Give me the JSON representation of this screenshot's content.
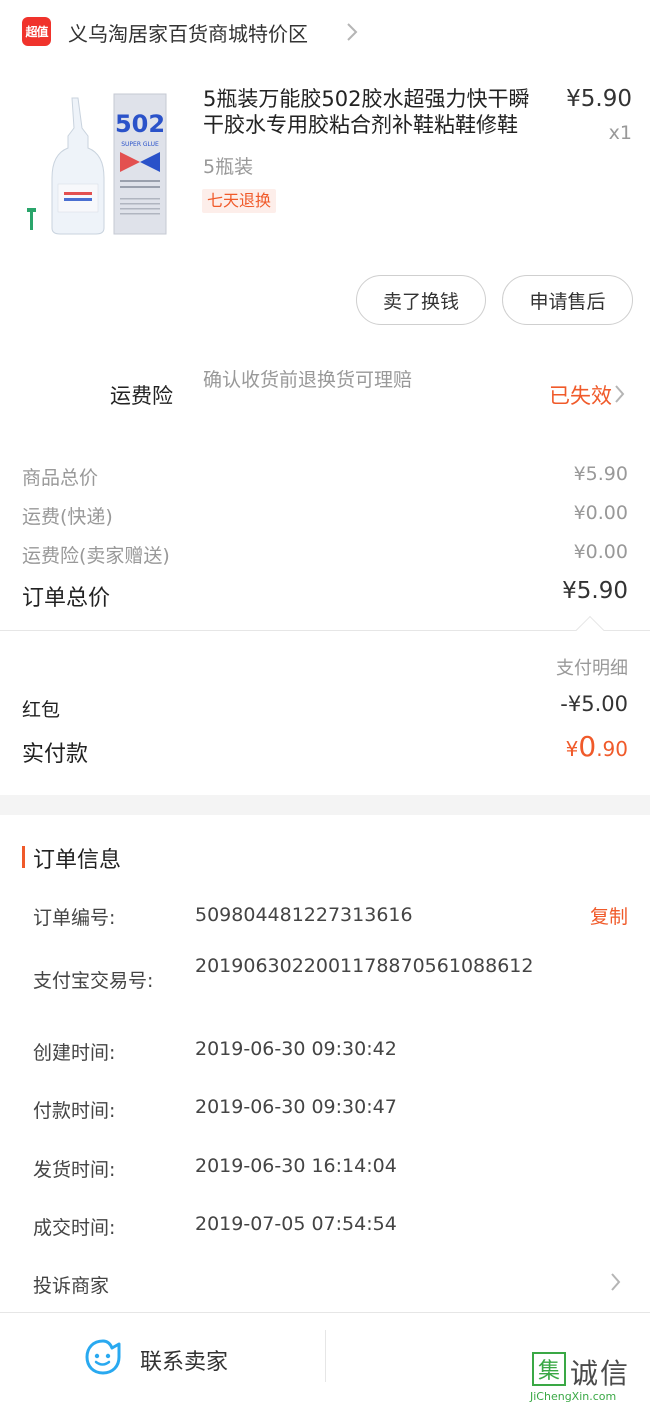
{
  "store": {
    "badge": "超值",
    "name": "义乌淘居家百货商城特价区"
  },
  "product": {
    "title": "5瓶装万能胶502胶水超强力快干瞬干胶水专用胶粘合剂补鞋粘鞋修鞋",
    "price": "¥5.90",
    "quantity": "x1",
    "sku": "5瓶装",
    "tag": "七天退换",
    "image_label": "502",
    "image_sub": "SUPER GLUE"
  },
  "actions": {
    "sell_label": "卖了换钱",
    "aftersale_label": "申请售后"
  },
  "insurance": {
    "label": "运费险",
    "description": "确认收货前退换货可理赔",
    "status": "已失效"
  },
  "price_rows": [
    {
      "label": "商品总价",
      "value": "¥5.90"
    },
    {
      "label": "运费(快递)",
      "value": "¥0.00"
    },
    {
      "label": "运费险(卖家赠送)",
      "value": "¥0.00"
    }
  ],
  "total": {
    "label": "订单总价",
    "value": "¥5.90"
  },
  "payment": {
    "detail_label": "支付明细",
    "hongbao_label": "红包",
    "hongbao_value": "-¥5.00",
    "paid_label": "实付款",
    "paid_currency": "¥",
    "paid_int": "0",
    "paid_dec": ".90"
  },
  "order_info": {
    "title": "订单信息",
    "copy_label": "复制",
    "rows": [
      {
        "label": "订单编号:",
        "value": "509804481227313616"
      },
      {
        "label": "支付宝交易号:",
        "value": "2019063022001178870561088612"
      },
      {
        "label": "创建时间:",
        "value": "2019-06-30 09:30:42"
      },
      {
        "label": "付款时间:",
        "value": "2019-06-30 09:30:47"
      },
      {
        "label": "发货时间:",
        "value": "2019-06-30 16:14:04"
      },
      {
        "label": "成交时间:",
        "value": "2019-07-05 07:54:54"
      }
    ],
    "complain_label": "投诉商家"
  },
  "bottom": {
    "contact_label": "联系卖家"
  },
  "watermark": {
    "glyph": "集",
    "text": "诚信",
    "url": "JiChengXin.com"
  },
  "colors": {
    "accent": "#f05a2a",
    "badge": "#f0332c",
    "icon_blue": "#29a9f0",
    "watermark_green": "#3aa845"
  }
}
